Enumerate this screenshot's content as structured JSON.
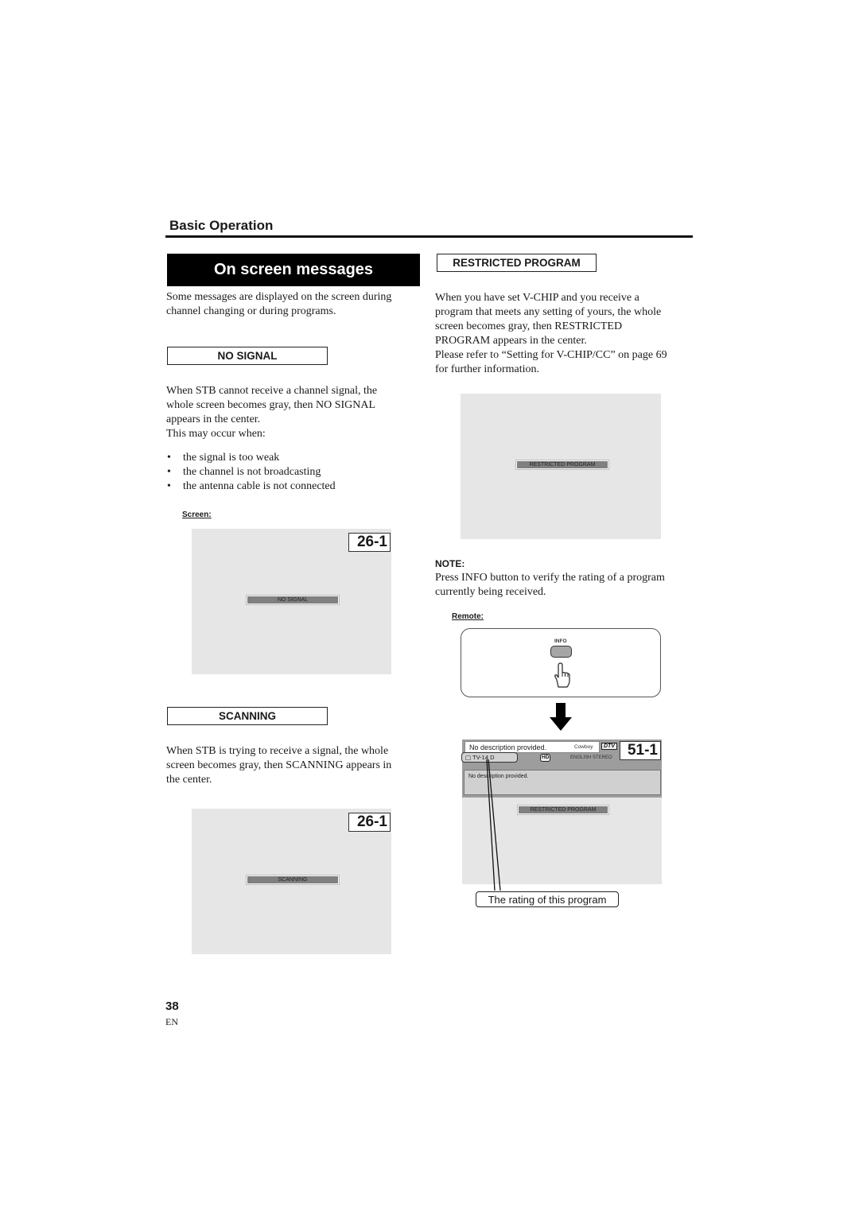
{
  "header": {
    "section_title": "Basic Operation",
    "banner_title": "On screen messages"
  },
  "intro": "Some messages are displayed on the screen during channel changing or during programs.",
  "no_signal": {
    "heading": "NO SIGNAL",
    "lines": [
      "When STB cannot receive a channel signal, the",
      "whole screen becomes gray, then NO SIGNAL",
      "appears in the center.",
      "This may occur when:"
    ],
    "bullets": [
      "the signal is too weak",
      "the channel is not broadcasting",
      "the antenna cable is not connected"
    ],
    "caption": "Screen:",
    "screen": {
      "channel": "26-1",
      "message": "NO SIGNAL"
    }
  },
  "scanning": {
    "heading": "SCANNING",
    "lines": [
      "When STB is trying to receive a signal, the whole",
      "screen becomes gray, then SCANNING appears in",
      "the center."
    ],
    "screen": {
      "channel": "26-1",
      "message": "SCANNING"
    }
  },
  "restricted": {
    "heading": "RESTRICTED PROGRAM",
    "lines": [
      "When you have set V-CHIP and you receive a",
      "program that meets any setting of yours, the whole",
      "screen becomes gray, then RESTRICTED",
      "PROGRAM appears in the center.",
      "Please refer to “Setting for V-CHIP/CC” on page 69",
      "for further information."
    ],
    "screen": {
      "message": "RESTRICTED PROGRAM"
    }
  },
  "note": {
    "title": "NOTE:",
    "lines": [
      "Press INFO button to verify the rating of a program",
      "currently being received."
    ],
    "caption": "Remote:"
  },
  "remote": {
    "button_label": "INFO",
    "icons": {
      "hand": "pointing-hand-icon",
      "arrow": "arrow-down-icon"
    }
  },
  "info_screen": {
    "description": "No description provided.",
    "genre": "Cowboy",
    "dtv_logo": "DTV",
    "channel": "51-1",
    "rating": "TV-14 D",
    "hd_badge": "HD",
    "audio": "ENGLISH STEREO",
    "detail": "No description provided.",
    "message": "RESTRICTED PROGRAM",
    "callout": "The rating of this program"
  },
  "footer": {
    "page_number": "38",
    "language": "EN"
  }
}
